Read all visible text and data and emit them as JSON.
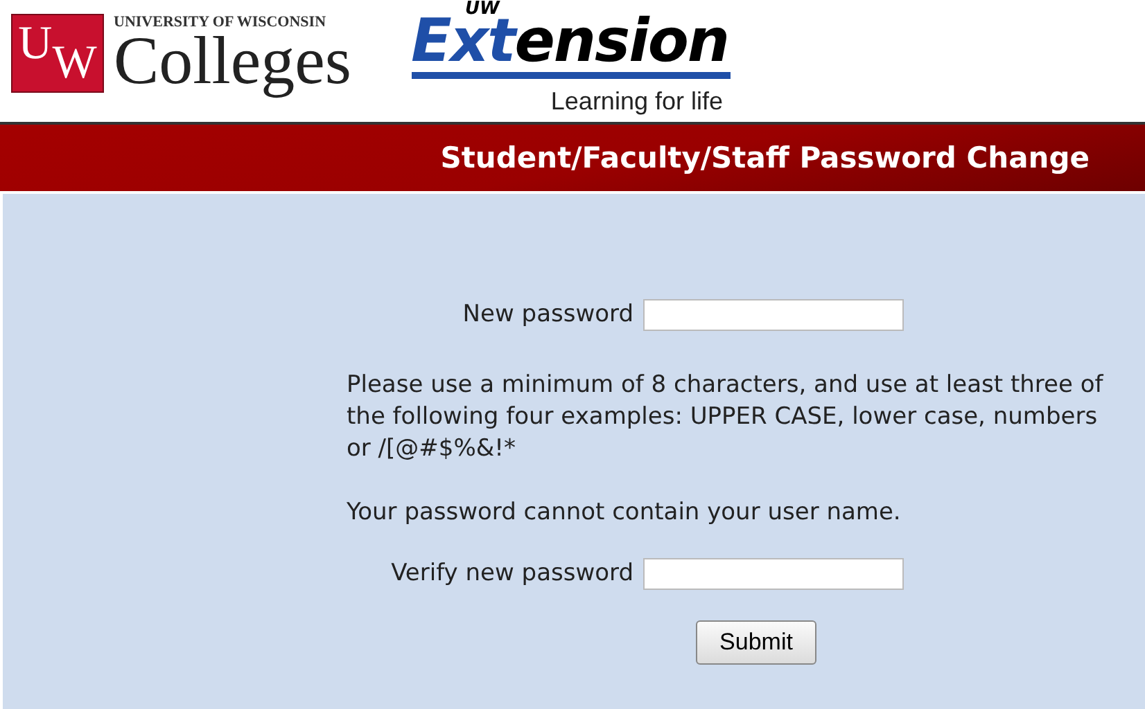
{
  "header": {
    "colleges_logo": {
      "monogram_letters": [
        "U",
        "W"
      ],
      "university": "UNIVERSITY OF WISCONSIN",
      "name": "Colleges"
    },
    "extension_logo": {
      "prefix": "UW",
      "word_blue": "Ext",
      "word_black": "ension",
      "tagline": "Learning for life"
    }
  },
  "banner": {
    "title": "Student/Faculty/Staff Password Change"
  },
  "form": {
    "fields": [
      {
        "label": "New password"
      }
    ],
    "notes": [
      "Please use a minimum of 8 characters, and use at least three of the following four examples: UPPER CASE, lower case, numbers or /[@#$%&!*",
      "Your password cannot contain your user name."
    ],
    "verify_field": {
      "label": "Verify new password"
    },
    "submit": "Submit"
  }
}
